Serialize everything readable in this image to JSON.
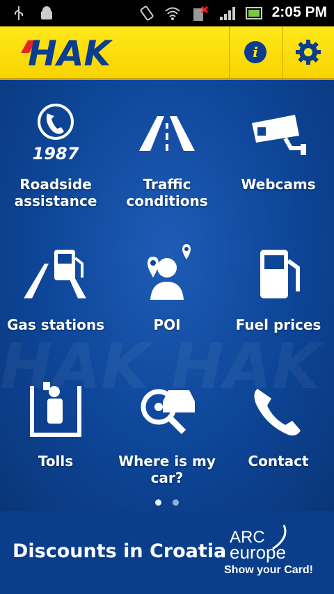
{
  "status_bar": {
    "time": "2:05 PM"
  },
  "header": {
    "logo_text": "HAK",
    "info_label": "i"
  },
  "grid": [
    {
      "label": "Roadside assistance",
      "icon": "roadside-assistance-icon",
      "extra": "1987"
    },
    {
      "label": "Traffic conditions",
      "icon": "traffic-road-icon"
    },
    {
      "label": "Webcams",
      "icon": "webcam-icon"
    },
    {
      "label": "Gas stations",
      "icon": "gas-station-icon"
    },
    {
      "label": "POI",
      "icon": "poi-person-icon"
    },
    {
      "label": "Fuel prices",
      "icon": "fuel-pump-icon"
    },
    {
      "label": "Tolls",
      "icon": "toll-booth-icon"
    },
    {
      "label": "Where is my car?",
      "icon": "find-car-icon"
    },
    {
      "label": "Contact",
      "icon": "phone-icon"
    }
  ],
  "pager": {
    "pages": 2,
    "active": 1
  },
  "footer": {
    "discount_text": "Discounts in Croatia",
    "arc_text": "ARC",
    "europe_text": "europe",
    "show_card_text": "Show your Card!"
  }
}
